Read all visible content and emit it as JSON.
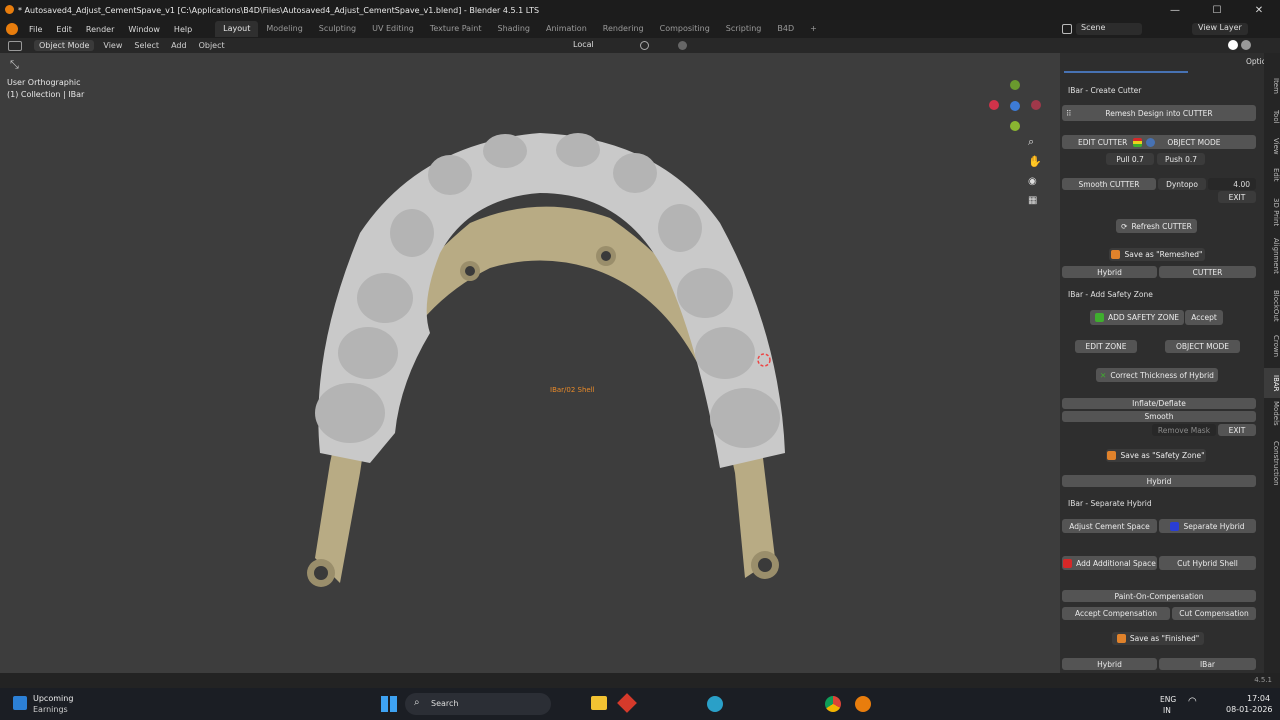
{
  "window": {
    "title": "* Autosaved4_Adjust_CementSpave_v1 [C:\\Applications\\B4D\\Files\\Autosaved4_Adjust_CementSpave_v1.blend] - Blender 4.5.1 LTS",
    "minimize": "—",
    "maximize": "☐",
    "close": "✕"
  },
  "menu": {
    "items": [
      "File",
      "Edit",
      "Render",
      "Window",
      "Help"
    ],
    "workspaces": [
      "Layout",
      "Modeling",
      "Sculpting",
      "UV Editing",
      "Texture Paint",
      "Shading",
      "Animation",
      "Rendering",
      "Compositing",
      "Scripting",
      "B4D"
    ],
    "add_tab": "+",
    "scene": "Scene",
    "view_layer": "View Layer"
  },
  "header": {
    "mode": "Object Mode",
    "items": [
      "View",
      "Select",
      "Add",
      "Object"
    ],
    "orientation": "Local",
    "options": "Options"
  },
  "viewport": {
    "view_name": "User Orthographic",
    "collection": "(1) Collection | IBar",
    "center_label": "IBar/02 Shell"
  },
  "tabs": [
    "Item",
    "Tool",
    "View",
    "Edit",
    "3D Print",
    "Alignment",
    "BlockOut",
    "Crown",
    "IBAR",
    "Models",
    "Construction"
  ],
  "panel": {
    "create_cutter": {
      "header": "IBar - Create Cutter",
      "remesh": "Remesh Design into CUTTER",
      "edit_cutter": "EDIT CUTTER",
      "object_mode": "OBJECT MODE",
      "pull": "Pull 0.7",
      "push": "Push 0.7",
      "smooth_cutter": "Smooth CUTTER",
      "dyntopo": "Dyntopo",
      "dyntopo_value": "4.00",
      "exit": "EXIT",
      "refresh": "Refresh CUTTER",
      "save_remeshed": "Save as \"Remeshed\"",
      "hybrid": "Hybrid",
      "cutter": "CUTTER"
    },
    "safety_zone": {
      "header": "IBar - Add Safety Zone",
      "add": "ADD SAFETY ZONE",
      "accept": "Accept",
      "edit_zone": "EDIT ZONE",
      "object_mode": "OBJECT MODE",
      "correct": "Correct Thickness of Hybrid",
      "inflate": "Inflate/Deflate",
      "smooth": "Smooth",
      "remove_mask": "Remove Mask",
      "exit": "EXIT",
      "save": "Save as \"Safety Zone\"",
      "hybrid": "Hybrid"
    },
    "separate_hybrid": {
      "header": "IBar - Separate Hybrid",
      "adjust": "Adjust Cement Space",
      "separate": "Separate Hybrid",
      "add_space": "Add Additional Space",
      "cut_shell": "Cut Hybrid Shell",
      "paint": "Paint-On-Compensation",
      "accept_comp": "Accept Compensation",
      "cut_comp": "Cut Compensation",
      "save_finished": "Save as \"Finished\"",
      "hybrid": "Hybrid",
      "ibar": "IBar"
    }
  },
  "statusbar": {
    "version": "4.5.1"
  },
  "taskbar": {
    "widget_title": "Upcoming",
    "widget_sub": "Earnings",
    "search": "Search",
    "lang1": "ENG",
    "lang2": "IN",
    "time": "17:04",
    "date": "08-01-2026"
  },
  "colors": {
    "accent": "#4772b3",
    "tooth": "#c9c9c9",
    "bar": "#b8ab84",
    "red": "#d62828",
    "green": "#3fae2e",
    "orange": "#e0822b"
  }
}
